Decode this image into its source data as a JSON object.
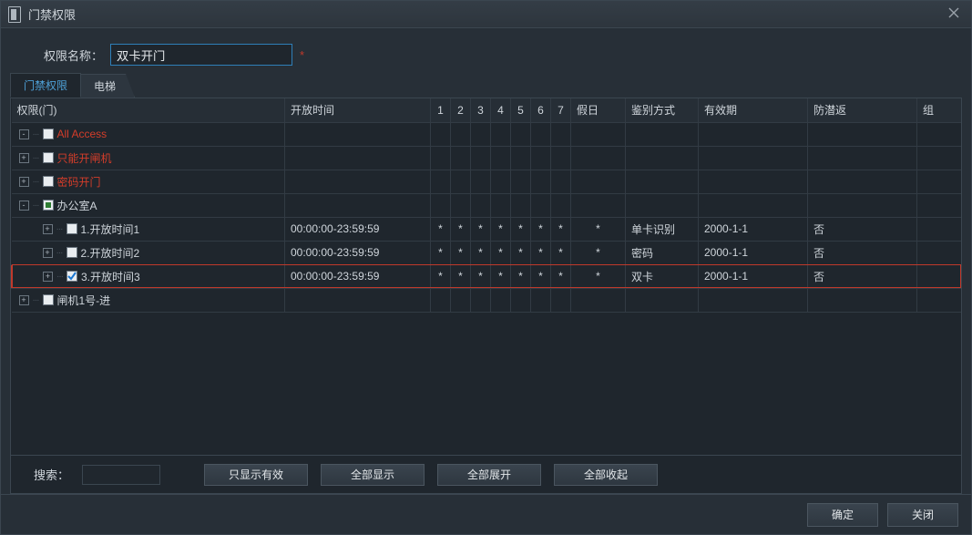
{
  "window": {
    "title": "门禁权限"
  },
  "form": {
    "name_label": "权限名称：",
    "name_value": "双卡开门",
    "required_mark": "*"
  },
  "tabs": [
    {
      "label": "门禁权限",
      "active": true
    },
    {
      "label": "电梯",
      "active": false
    }
  ],
  "columns": {
    "tree": "权限(门)",
    "time": "开放时间",
    "d1": "1",
    "d2": "2",
    "d3": "3",
    "d4": "4",
    "d5": "5",
    "d6": "6",
    "d7": "7",
    "holiday": "假日",
    "auth": "鉴别方式",
    "expire": "有效期",
    "anti": "防潜返",
    "group": "组"
  },
  "rows": [
    {
      "type": "group",
      "indent": 1,
      "expand": "-",
      "check": "off",
      "label": "All Access",
      "red": true
    },
    {
      "type": "group",
      "indent": 1,
      "expand": "+",
      "check": "off",
      "label": "只能开闸机",
      "red": true
    },
    {
      "type": "group",
      "indent": 1,
      "expand": "+",
      "check": "off",
      "label": "密码开门",
      "red": true
    },
    {
      "type": "group",
      "indent": 1,
      "expand": "-",
      "check": "part",
      "label": "办公室A",
      "red": false
    },
    {
      "type": "leaf",
      "indent": 2,
      "expand": "+",
      "check": "off",
      "label": "1.开放时间1",
      "time": "00:00:00-23:59:59",
      "d": [
        "*",
        "*",
        "*",
        "*",
        "*",
        "*",
        "*"
      ],
      "holiday": "*",
      "auth": "单卡识别",
      "expire": "2000-1-1",
      "anti": "否",
      "group": ""
    },
    {
      "type": "leaf",
      "indent": 2,
      "expand": "+",
      "check": "off",
      "label": "2.开放时间2",
      "time": "00:00:00-23:59:59",
      "d": [
        "*",
        "*",
        "*",
        "*",
        "*",
        "*",
        "*"
      ],
      "holiday": "*",
      "auth": "密码",
      "expire": "2000-1-1",
      "anti": "否",
      "group": ""
    },
    {
      "type": "leaf",
      "indent": 2,
      "expand": "+",
      "check": "on",
      "label": "3.开放时间3",
      "time": "00:00:00-23:59:59",
      "d": [
        "*",
        "*",
        "*",
        "*",
        "*",
        "*",
        "*"
      ],
      "holiday": "*",
      "auth": "双卡",
      "expire": "2000-1-1",
      "anti": "否",
      "group": "",
      "highlight": true
    },
    {
      "type": "group",
      "indent": 1,
      "expand": "+",
      "check": "off",
      "label": "闸机1号-进",
      "red": false
    }
  ],
  "toolbar": {
    "search_label": "搜索：",
    "search_value": "",
    "btn_valid": "只显示有效",
    "btn_showall": "全部显示",
    "btn_expand": "全部展开",
    "btn_collapse": "全部收起"
  },
  "footer": {
    "ok": "确定",
    "close": "关闭"
  }
}
